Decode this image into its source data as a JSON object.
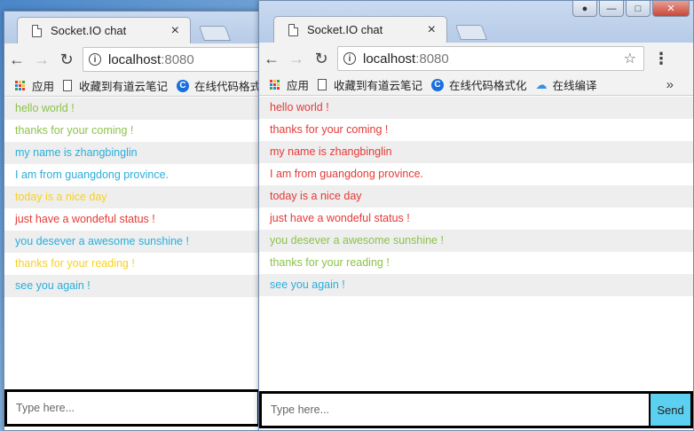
{
  "colors": {
    "green": "#8bc34a",
    "blue": "#29aedb",
    "yellow": "#f7d21e",
    "red": "#e53935",
    "send_button": "#5bd0f0"
  },
  "windows": [
    {
      "tab": {
        "title": "Socket.IO chat",
        "close": "×"
      },
      "address": {
        "host": "localhost",
        "port": ":8080"
      },
      "bookmarks": [
        "应用",
        "收藏到有道云笔记",
        "在线代码格式"
      ],
      "messages": [
        {
          "text": "hello world !",
          "color": "#8bc34a"
        },
        {
          "text": "thanks for your coming !",
          "color": "#8bc34a"
        },
        {
          "text": "my name is zhangbinglin",
          "color": "#29aedb"
        },
        {
          "text": "I am from guangdong province.",
          "color": "#29aedb"
        },
        {
          "text": "today is a nice day",
          "color": "#f7d21e"
        },
        {
          "text": "just have a wondeful status !",
          "color": "#e53935"
        },
        {
          "text": "you desever a awesome sunshine !",
          "color": "#29aedb"
        },
        {
          "text": "thanks for your reading !",
          "color": "#f7d21e"
        },
        {
          "text": "see you again !",
          "color": "#29aedb"
        }
      ],
      "input_placeholder": "Type here..."
    },
    {
      "tab": {
        "title": "Socket.IO chat",
        "close": "×"
      },
      "address": {
        "host": "localhost",
        "port": ":8080"
      },
      "bookmarks": [
        "应用",
        "收藏到有道云笔记",
        "在线代码格式化",
        "在线编译"
      ],
      "bookmarks_more": "»",
      "messages": [
        {
          "text": "hello world !",
          "color": "#e53935"
        },
        {
          "text": "thanks for your coming !",
          "color": "#e53935"
        },
        {
          "text": "my name is zhangbinglin",
          "color": "#e53935"
        },
        {
          "text": "I am from guangdong province.",
          "color": "#e53935"
        },
        {
          "text": "today is a nice day",
          "color": "#e53935"
        },
        {
          "text": "just have a wondeful status !",
          "color": "#e53935"
        },
        {
          "text": "you desever a awesome sunshine !",
          "color": "#8bc34a"
        },
        {
          "text": "thanks for your reading !",
          "color": "#8bc34a"
        },
        {
          "text": "see you again !",
          "color": "#29aedb"
        }
      ],
      "input_placeholder": "Type here...",
      "send_label": "Send"
    }
  ]
}
